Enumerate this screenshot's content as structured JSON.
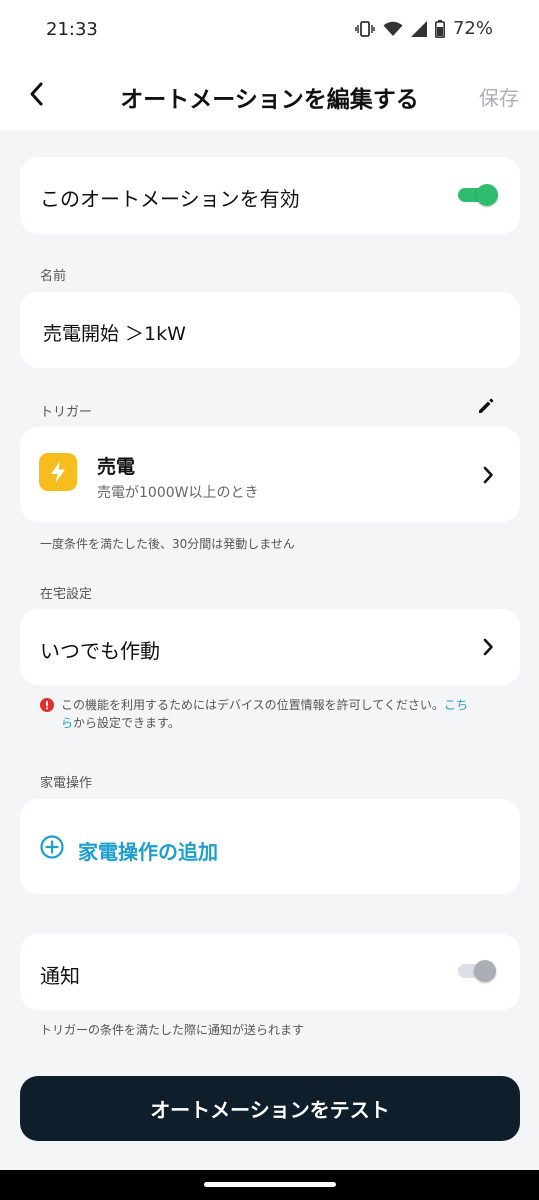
{
  "status_bar": {
    "time": "21:33",
    "battery": "72%"
  },
  "app_bar": {
    "title": "オートメーションを編集する",
    "save_label": "保存"
  },
  "enable_card": {
    "label": "このオートメーションを有効",
    "enabled": true
  },
  "name_section": {
    "label": "名前",
    "value": "売電開始 ＞1kW"
  },
  "trigger_section": {
    "label": "トリガー",
    "title": "売電",
    "subtitle": "売電が1000W以上のとき",
    "note": "一度条件を満たした後、30分間は発動しません"
  },
  "home_section": {
    "label": "在宅設定",
    "value": "いつでも作動",
    "warning_text": "この機能を利用するためにはデバイスの位置情報を許可してください。",
    "warning_link_1": "こち",
    "warning_link_2": "ら",
    "warning_text_2": "から設定できます。"
  },
  "appliance_section": {
    "label": "家電操作",
    "add_label": "家電操作の追加"
  },
  "notify_card": {
    "label": "通知",
    "enabled": false,
    "note": "トリガーの条件を満たした際に通知が送られます"
  },
  "test_button": {
    "label": "オートメーションをテスト"
  },
  "colors": {
    "accent_green": "#2ebd6f",
    "accent_blue": "#1e9fcf",
    "trigger_icon_bg": "#f7bd1d",
    "warning_red": "#e03030",
    "dark_button": "#0f1e2b"
  }
}
